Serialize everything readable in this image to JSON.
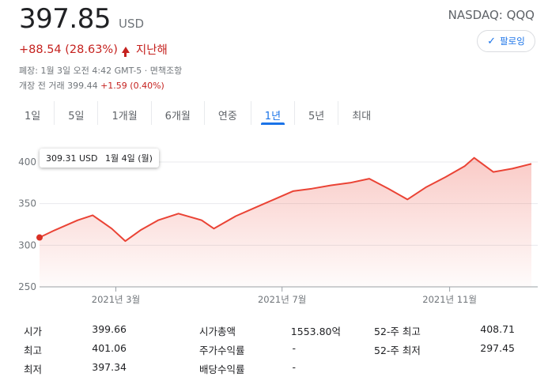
{
  "quote": {
    "price": "397.85",
    "currency": "USD",
    "ticker": "NASDAQ: QQQ",
    "change": "+88.54 (28.63%)",
    "change_period": "지난해",
    "close_info": "폐장: 1월 3일 오전 4:42 GMT-5 · 면책조항",
    "premarket_label": "개장 전 거래 399.44",
    "premarket_change": "+1.59 (0.40%)"
  },
  "follow_button": {
    "check": "✓",
    "label": "팔로잉"
  },
  "tabs": [
    "1일",
    "5일",
    "1개월",
    "6개월",
    "연중",
    "1년",
    "5년",
    "최대"
  ],
  "tooltip": {
    "value": "309.31 USD",
    "date": "1월 4일 (월)"
  },
  "colors": {
    "up": "#c5221f",
    "line": "#ea4335",
    "accent": "#1a73e8"
  },
  "chart_data": {
    "type": "area",
    "title": "",
    "xlabel": "",
    "ylabel": "",
    "ylim": [
      250,
      400
    ],
    "yticks": [
      400,
      350,
      300,
      250
    ],
    "xtick_labels": [
      "2021년 3월",
      "2021년 7월",
      "2021년 11월"
    ],
    "x": [
      "2021-01-04",
      "2021-01-15",
      "2021-02-01",
      "2021-02-12",
      "2021-02-26",
      "2021-03-08",
      "2021-03-19",
      "2021-04-01",
      "2021-04-16",
      "2021-05-03",
      "2021-05-12",
      "2021-05-28",
      "2021-06-11",
      "2021-06-25",
      "2021-07-09",
      "2021-07-23",
      "2021-08-06",
      "2021-08-20",
      "2021-09-03",
      "2021-09-17",
      "2021-10-01",
      "2021-10-15",
      "2021-10-29",
      "2021-11-12",
      "2021-11-19",
      "2021-12-03",
      "2021-12-17",
      "2021-12-31"
    ],
    "series": [
      {
        "values": [
          309.31,
          318,
          330,
          336,
          320,
          305,
          318,
          330,
          338,
          330,
          320,
          335,
          345,
          355,
          365,
          368,
          372,
          375,
          380,
          368,
          355,
          370,
          382,
          395,
          405,
          388,
          392,
          397.85
        ]
      }
    ]
  },
  "stats": {
    "col1": [
      {
        "label": "시가",
        "value": "399.66"
      },
      {
        "label": "최고",
        "value": "401.06"
      },
      {
        "label": "최저",
        "value": "397.34"
      }
    ],
    "col2": [
      {
        "label": "시가총액",
        "value": "1553.80억"
      },
      {
        "label": "주가수익률",
        "value": "-"
      },
      {
        "label": "배당수익률",
        "value": "-"
      }
    ],
    "col3": [
      {
        "label": "52-주 최고",
        "value": "408.71"
      },
      {
        "label": "52-주 최저",
        "value": "297.45"
      }
    ]
  }
}
